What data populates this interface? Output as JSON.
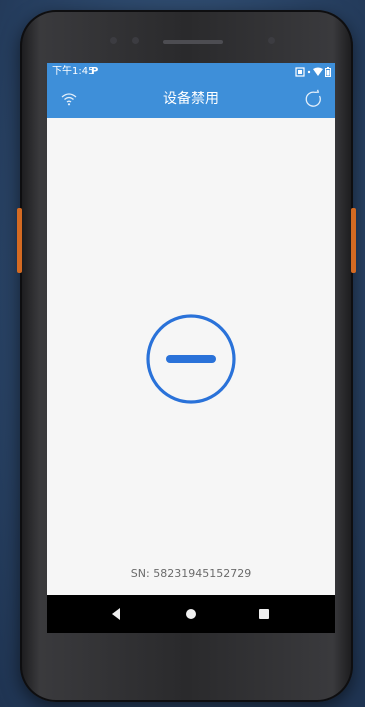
{
  "status_bar": {
    "time": "下午1:45",
    "notification": "P"
  },
  "app_bar": {
    "title": "设备禁用"
  },
  "content": {
    "state_icon": "minus-circle-icon",
    "serial_text": "SN: 58231945152729"
  },
  "icons": {
    "wifi": "wifi-icon",
    "refresh": "refresh-icon",
    "back": "nav-back-icon",
    "home": "nav-home-icon",
    "recent": "nav-recent-icon"
  },
  "colors": {
    "appbar": "#3e8fd9",
    "accent": "#2a72d9",
    "background": "#f6f6f6",
    "sn_text": "#6b6b6b"
  }
}
